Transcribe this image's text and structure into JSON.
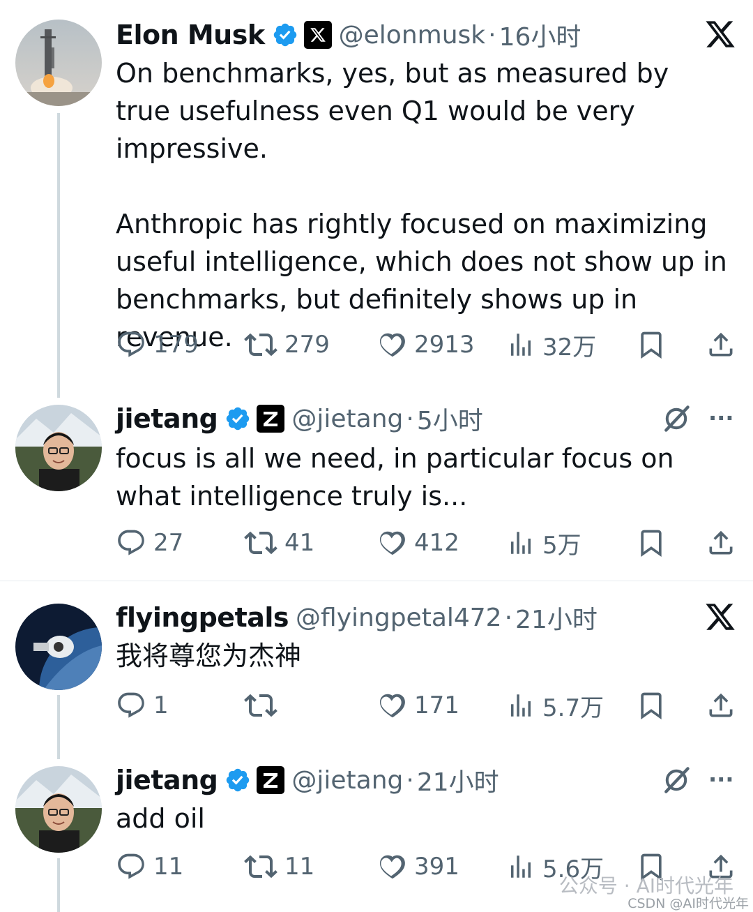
{
  "tweets": [
    {
      "name": "Elon Musk",
      "handle": "@elonmusk",
      "separator": "·",
      "time": "16小时",
      "text": "On benchmarks, yes, but as measured by true usefulness even Q1 would be very impressive.\n\nAnthropic has rightly focused on maximizing useful intelligence, which does not show up in benchmarks, but definitely shows up in revenue.",
      "stats": {
        "replies": "179",
        "retweets": "279",
        "likes": "2913",
        "views": "32万"
      }
    },
    {
      "name": "jietang",
      "handle": "@jietang",
      "separator": "·",
      "time": "5小时",
      "text": "focus is all we need, in particular focus on what intelligence truly is...",
      "stats": {
        "replies": "27",
        "retweets": "41",
        "likes": "412",
        "views": "5万"
      }
    },
    {
      "name": "flyingpetals",
      "handle": "@flyingpetal472",
      "separator": "·",
      "time": "21小时",
      "text": "我将尊您为杰神",
      "stats": {
        "replies": "1",
        "retweets": "",
        "likes": "171",
        "views": "5.7万"
      }
    },
    {
      "name": "jietang",
      "handle": "@jietang",
      "separator": "·",
      "time": "21小时",
      "text": "add oil",
      "stats": {
        "replies": "11",
        "retweets": "11",
        "likes": "391",
        "views": "5.6万"
      }
    }
  ],
  "more_label": "···",
  "watermark": {
    "primary": "公众号 · AI时代光年",
    "secondary": "CSDN @AI时代光年"
  },
  "colors": {
    "text": "#0f1419",
    "muted": "#536471",
    "verified": "#1d9bf0",
    "thread_line": "#cfd9de"
  },
  "icons": {
    "reply": "speech-bubble-icon",
    "retweet": "retweet-icon",
    "like": "heart-icon",
    "views": "bar-chart-icon",
    "bookmark": "bookmark-icon",
    "share": "share-icon",
    "x_logo": "x-logo-icon",
    "grok": "grok-icon"
  }
}
